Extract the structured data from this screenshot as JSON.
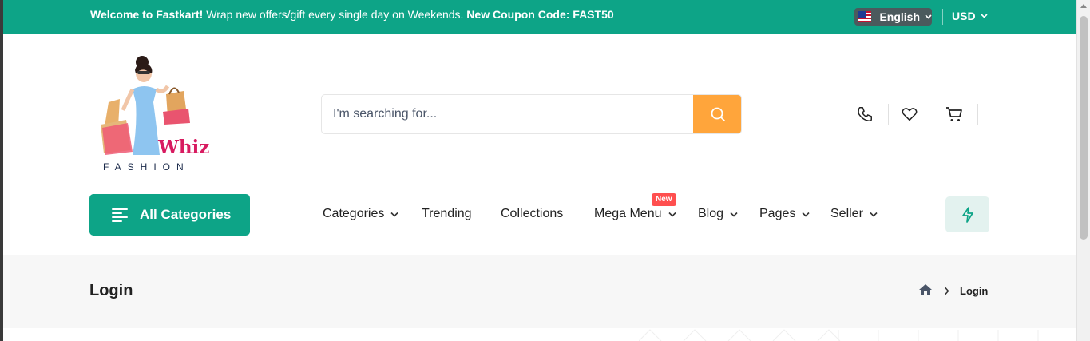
{
  "topbar": {
    "welcome_bold": "Welcome to Fastkart!",
    "welcome_text": " Wrap new offers/gift every single day on Weekends. ",
    "coupon_text": "New Coupon Code: FAST50",
    "language": "English",
    "currency": "USD",
    "colors": {
      "background": "#0da487"
    }
  },
  "logo": {
    "brand": "Whiz",
    "subtitle": "FASHION"
  },
  "search": {
    "placeholder": "I'm searching for...",
    "button_color": "#ffa53b"
  },
  "header_icons": [
    "phone-icon",
    "heart-icon",
    "cart-icon"
  ],
  "all_categories": {
    "label": "All Categories"
  },
  "nav": {
    "items": [
      {
        "label": "Categories",
        "dropdown": true
      },
      {
        "label": "Trending",
        "dropdown": false
      },
      {
        "label": "Collections",
        "dropdown": false
      },
      {
        "label": "Mega Menu",
        "dropdown": true,
        "badge": "New"
      },
      {
        "label": "Blog",
        "dropdown": true
      },
      {
        "label": "Pages",
        "dropdown": true
      },
      {
        "label": "Seller",
        "dropdown": true
      }
    ]
  },
  "breadcrumb": {
    "title": "Login",
    "current": "Login"
  }
}
